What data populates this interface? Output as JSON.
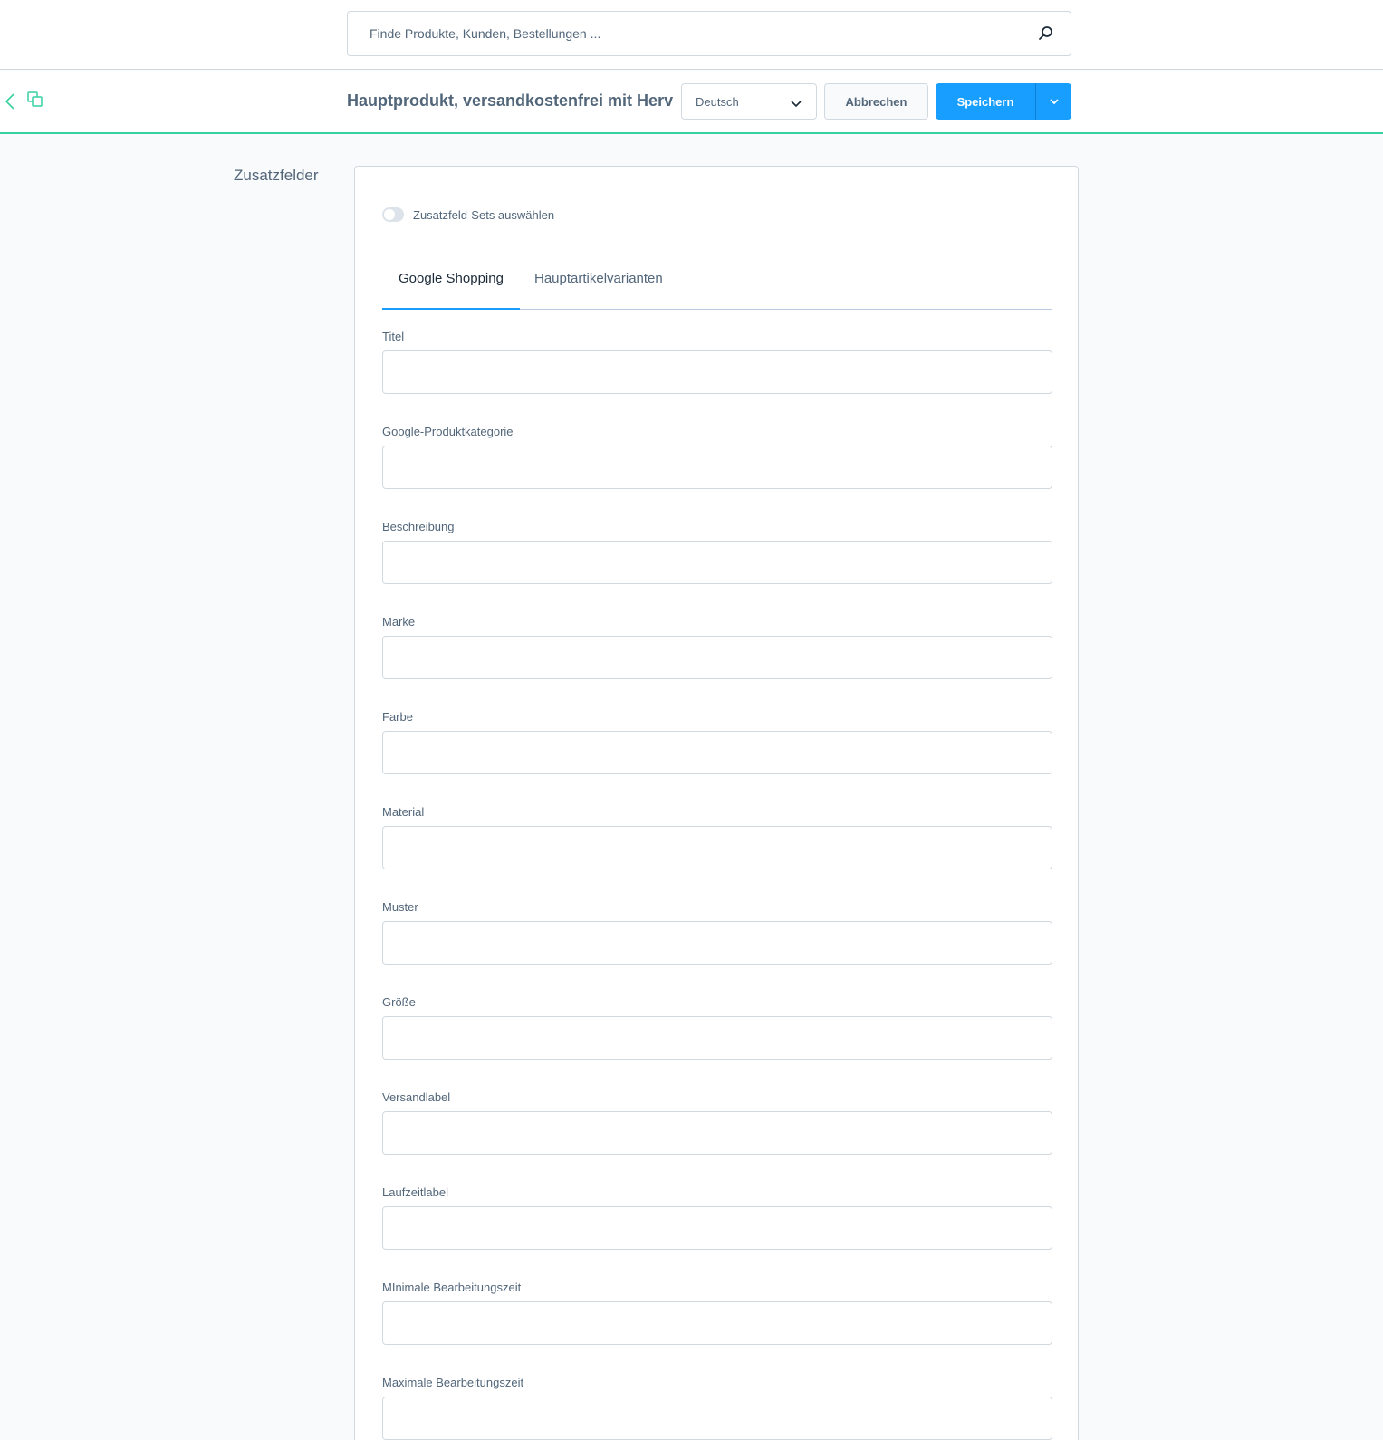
{
  "search": {
    "placeholder": "Finde Produkte, Kunden, Bestellungen ..."
  },
  "smartbar": {
    "title": "Hauptprodukt, versandkostenfrei mit Herv...",
    "language": "Deutsch",
    "cancel_label": "Abbrechen",
    "save_label": "Speichern"
  },
  "section": {
    "label": "Zusatzfelder"
  },
  "toggle": {
    "label": "Zusatzfeld-Sets auswählen",
    "enabled": false
  },
  "tabs": [
    {
      "label": "Google Shopping",
      "active": true
    },
    {
      "label": "Hauptartikelvarianten",
      "active": false
    }
  ],
  "fields": [
    {
      "label": "Titel",
      "value": ""
    },
    {
      "label": "Google-Produktkategorie",
      "value": ""
    },
    {
      "label": "Beschreibung",
      "value": ""
    },
    {
      "label": "Marke",
      "value": ""
    },
    {
      "label": "Farbe",
      "value": ""
    },
    {
      "label": "Material",
      "value": ""
    },
    {
      "label": "Muster",
      "value": ""
    },
    {
      "label": "Größe",
      "value": ""
    },
    {
      "label": "Versandlabel",
      "value": ""
    },
    {
      "label": "Laufzeitlabel",
      "value": ""
    },
    {
      "label": "MInimale Bearbeitungszeit",
      "value": ""
    },
    {
      "label": "Maximale Bearbeitungszeit",
      "value": ""
    }
  ],
  "colors": {
    "accent": "#189eff",
    "smartbar_border": "#37d0a0",
    "text": "#52667a"
  },
  "icons": [
    "search-icon",
    "back-icon",
    "copy-icon",
    "chevron-down-icon"
  ]
}
